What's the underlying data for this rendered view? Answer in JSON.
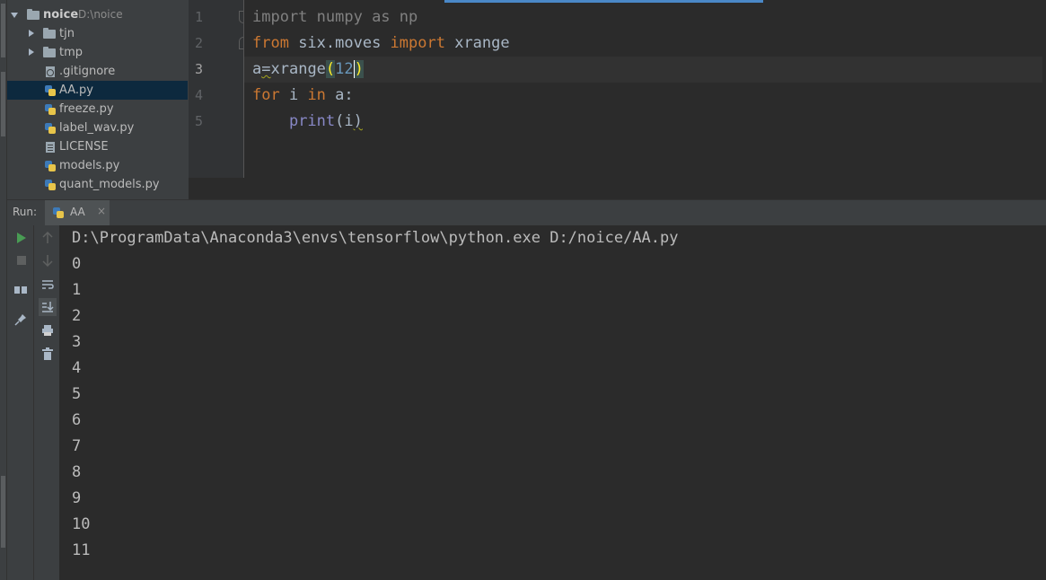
{
  "project": {
    "root_name": "noice",
    "root_path": "D:\\noice",
    "items": [
      {
        "label": "tjn",
        "kind": "folder"
      },
      {
        "label": "tmp",
        "kind": "folder"
      },
      {
        "label": ".gitignore",
        "kind": "file"
      },
      {
        "label": "AA.py",
        "kind": "python",
        "selected": true
      },
      {
        "label": "freeze.py",
        "kind": "python"
      },
      {
        "label": "label_wav.py",
        "kind": "python"
      },
      {
        "label": "LICENSE",
        "kind": "file"
      },
      {
        "label": "models.py",
        "kind": "python"
      },
      {
        "label": "quant_models.py",
        "kind": "python"
      }
    ]
  },
  "editor": {
    "line_numbers": [
      "1",
      "2",
      "3",
      "4",
      "5"
    ],
    "current_line": 3,
    "code": {
      "l1_kw": "import",
      "l1_rest": " numpy as np",
      "l2_kw1": "from",
      "l2_mid": " six.moves ",
      "l2_kw2": "import",
      "l2_rest": " xrange",
      "l3_a": "a",
      "l3_eq": "=",
      "l3_fn": "xrange",
      "l3_open": "(",
      "l3_num": "12",
      "l3_close": ")",
      "l4_kw1": "for",
      "l4_mid": " i ",
      "l4_kw2": "in",
      "l4_rest": " a:",
      "l5_indent": "    ",
      "l5_fn": "print",
      "l5_open": "(",
      "l5_arg": "i",
      "l5_close": ")"
    }
  },
  "run": {
    "label": "Run:",
    "tab": "AA",
    "tab_close": "×",
    "command": "D:\\ProgramData\\Anaconda3\\envs\\tensorflow\\python.exe D:/noice/AA.py",
    "output": [
      "0",
      "1",
      "2",
      "3",
      "4",
      "5",
      "6",
      "7",
      "8",
      "9",
      "10",
      "11"
    ]
  },
  "colors": {
    "keyword": "#cc7832",
    "number": "#6897bb",
    "builtin": "#8888c6",
    "run_green": "#499c54",
    "selection": "#0d293e"
  }
}
